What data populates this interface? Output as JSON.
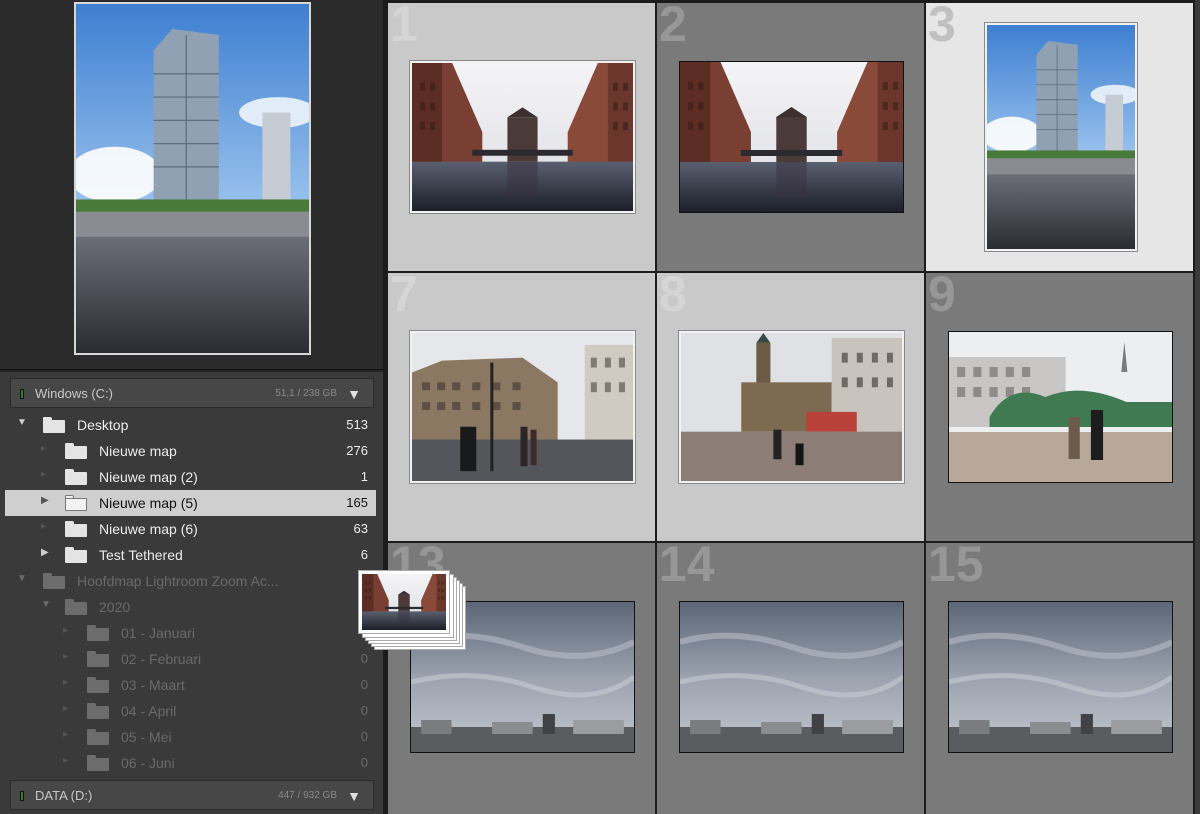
{
  "volumes": {
    "windows": {
      "name": "Windows (C:)",
      "size": "51,1 / 238 GB",
      "icon": "triangle-down-icon"
    },
    "data": {
      "name": "DATA (D:)",
      "size": "447 / 932 GB",
      "icon": "triangle-down-icon"
    }
  },
  "folders": [
    {
      "label": "Desktop",
      "count": "513"
    },
    {
      "label": "Nieuwe map",
      "count": "276"
    },
    {
      "label": "Nieuwe map (2)",
      "count": "1"
    },
    {
      "label": "Nieuwe map (5)",
      "count": "165"
    },
    {
      "label": "Nieuwe map (6)",
      "count": "63"
    },
    {
      "label": "Test Tethered",
      "count": "6"
    },
    {
      "label": "Hoofdmap Lightroom Zoom Ac...",
      "count": ""
    },
    {
      "label": "2020",
      "count": ""
    },
    {
      "label": "01 - Januari",
      "count": "0"
    },
    {
      "label": "02 - Februari",
      "count": "0"
    },
    {
      "label": "03 - Maart",
      "count": "0"
    },
    {
      "label": "04 - April",
      "count": "0"
    },
    {
      "label": "05 - Mei",
      "count": "0"
    },
    {
      "label": "06 - Juni",
      "count": "0"
    }
  ],
  "grid": {
    "cells": [
      {
        "number": "1"
      },
      {
        "number": "2"
      },
      {
        "number": "3"
      },
      {
        "number": "7"
      },
      {
        "number": "8"
      },
      {
        "number": "9"
      },
      {
        "number": "13"
      },
      {
        "number": "14"
      },
      {
        "number": "15"
      }
    ]
  },
  "colors": {
    "cell_light": "#c9c9c9",
    "cell_mid": "#7a7a7a",
    "cell_selected": "#e6e6e6",
    "selection_row": "#cfcfcf"
  }
}
